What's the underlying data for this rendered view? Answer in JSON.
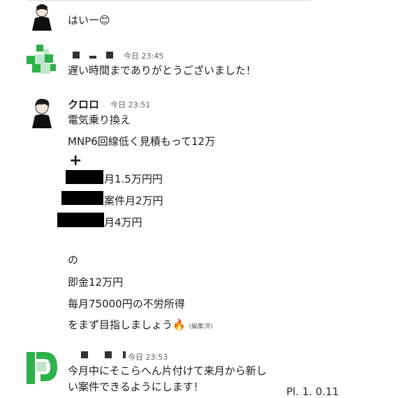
{
  "messages": [
    {
      "text": "はいー😊"
    },
    {
      "time": "今日 23:45",
      "text": "遅い時間までありがとうございました！"
    },
    {
      "name": "クロロ",
      "time": "今日 23:51",
      "lines": [
        "電気乗り換え",
        "MNP6回線低く見積もって12万",
        "+",
        "月1.5万円円",
        "案件月2万円",
        "月4万円",
        "の",
        "即金12万円",
        "毎月75000円の不労所得",
        "をまず目指しましょう🔥"
      ],
      "edited_label": "(編集済)"
    },
    {
      "time": "今日 23:53",
      "lines": [
        "今月中にそこらへん片付けて来月から新し",
        "い案件できるようにします！"
      ]
    }
  ],
  "cutoff_text": "Pl. 1. 0.11",
  "colors": {
    "green_avatar": "#2db24a",
    "redaction": "#000000"
  },
  "icons": [
    "user-avatar-icon",
    "green-pixel-avatar-icon",
    "green-d-avatar-icon",
    "fire-emoji"
  ]
}
